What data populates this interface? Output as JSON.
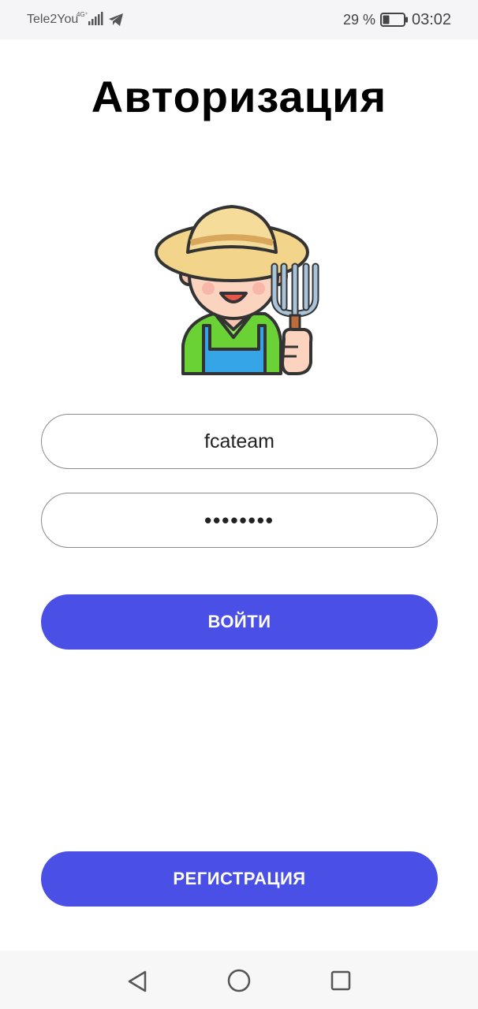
{
  "status_bar": {
    "carrier": "Tele2You",
    "network_label": "4G⁺",
    "network_icon": "signal-bars-icon",
    "notification_icon": "telegram-icon",
    "battery_percent": "29 %",
    "battery_level": 0.29,
    "time": "03:02"
  },
  "header": {
    "title": "Авторизация"
  },
  "avatar": {
    "icon": "farmer-with-pitchfork-icon"
  },
  "form": {
    "login_value": "fcateam",
    "password_value": "••••••••",
    "login_button_label": "ВОЙТИ"
  },
  "register": {
    "button_label": "РЕГИСТРАЦИЯ"
  },
  "nav": {
    "back_icon": "back-triangle-icon",
    "home_icon": "home-circle-icon",
    "recent_icon": "recent-square-icon"
  },
  "colors": {
    "accent": "#4a50e6",
    "status_bar_bg": "#f5f5f7",
    "nav_bar_bg": "#f7f7f7"
  }
}
